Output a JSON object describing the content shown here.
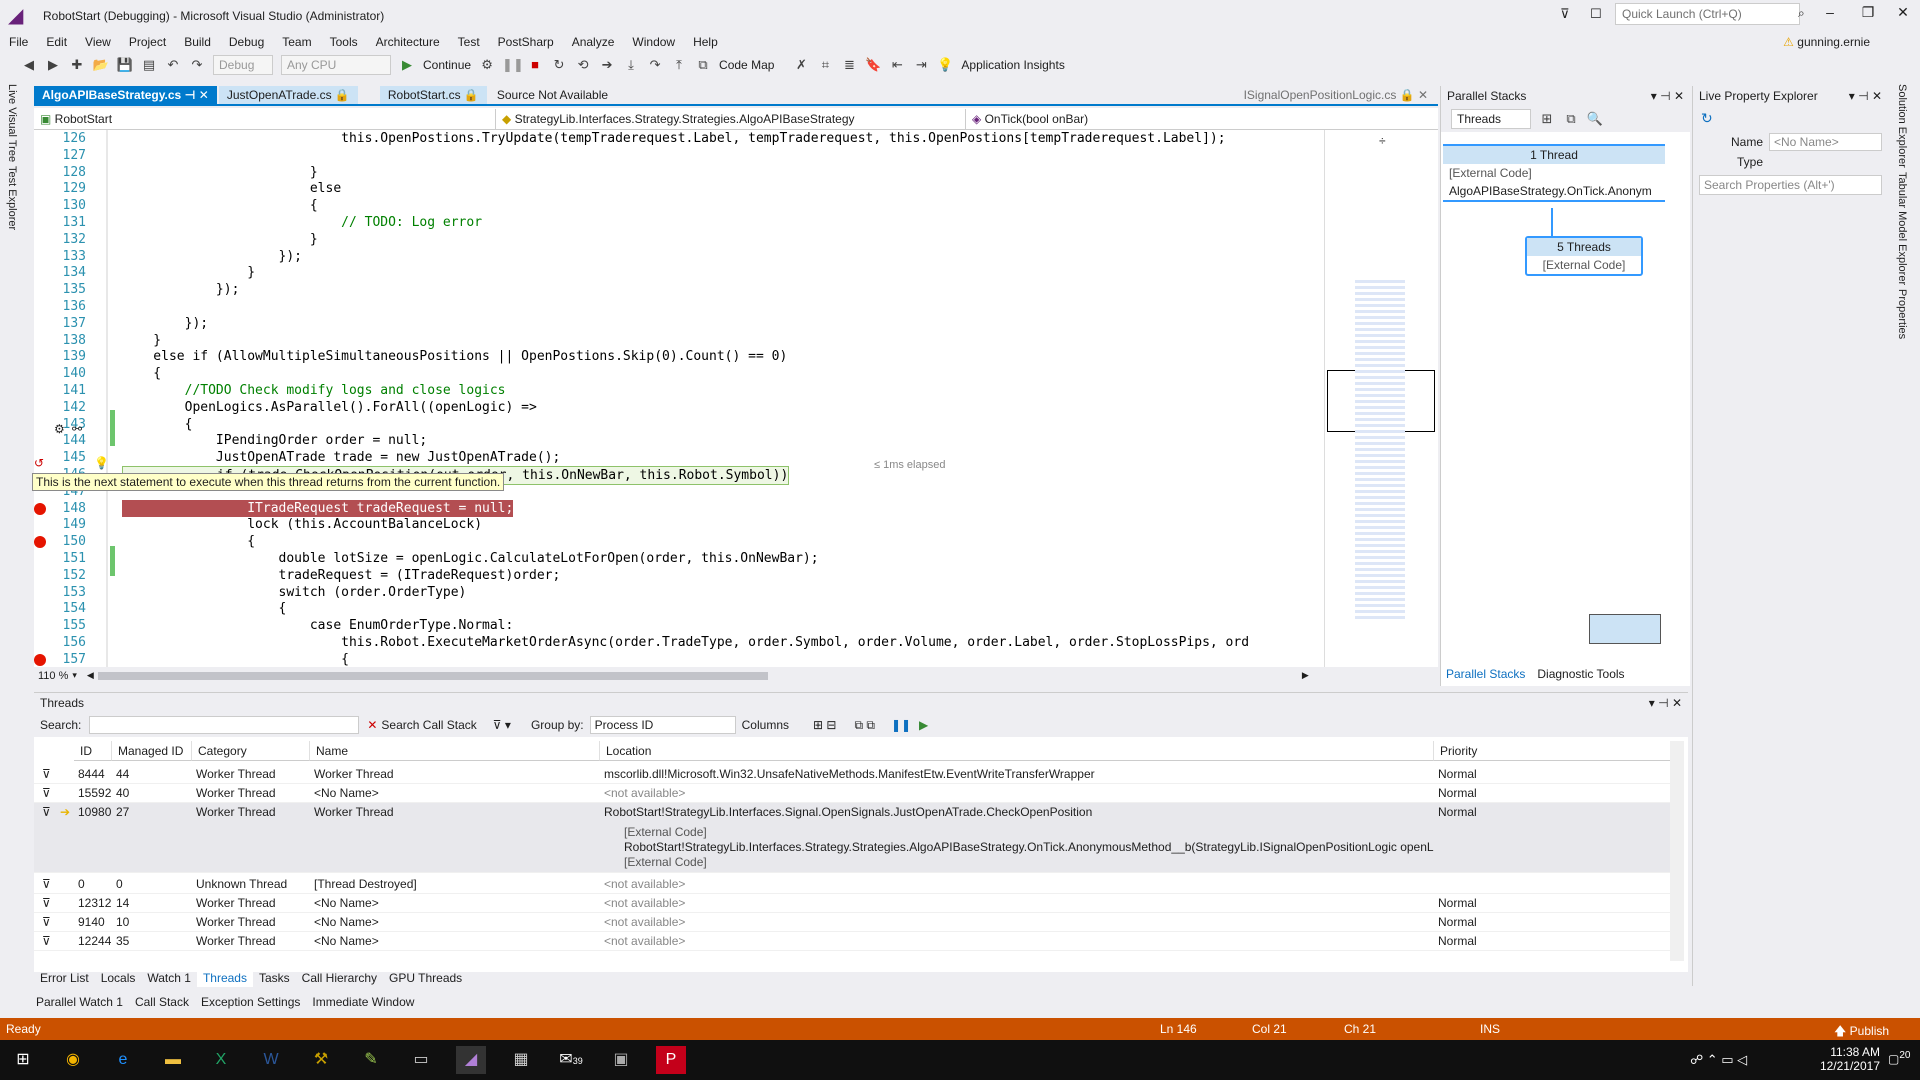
{
  "window": {
    "title": "RobotStart (Debugging) - Microsoft Visual Studio (Administrator)",
    "quick_launch_placeholder": "Quick Launch (Ctrl+Q)",
    "user": "gunning.ernie"
  },
  "menu": [
    "File",
    "Edit",
    "View",
    "Project",
    "Build",
    "Debug",
    "Team",
    "Tools",
    "Architecture",
    "Test",
    "PostSharp",
    "Analyze",
    "Window",
    "Help"
  ],
  "toolbar": {
    "config": "Debug",
    "platform": "Any CPU",
    "continue_label": "Continue",
    "code_map_label": "Code Map",
    "app_insights_label": "Application Insights"
  },
  "left_strip": [
    "Live Visual Tree",
    "Test Explorer"
  ],
  "right_strip": [
    "Solution Explorer",
    "Tabular Model Explorer",
    "Properties"
  ],
  "doc_tabs": [
    {
      "label": "AlgoAPIBaseStrategy.cs",
      "active": true
    },
    {
      "label": "JustOpenATrade.cs",
      "active": false
    },
    {
      "label": "RobotStart.cs",
      "active": false
    },
    {
      "label": "Source Not Available",
      "active": false
    },
    {
      "label": "ISignalOpenPositionLogic.cs",
      "active": false
    }
  ],
  "nav_bar": {
    "project": "RobotStart",
    "class": "StrategyLib.Interfaces.Strategy.Strategies.AlgoAPIBaseStrategy",
    "method": "OnTick(bool onBar)"
  },
  "code_lines": [
    {
      "n": "126",
      "t": "                            this.OpenPostions.TryUpdate(tempTraderequest.Label, tempTraderequest, this.OpenPostions[tempTraderequest.Label]);"
    },
    {
      "n": "127",
      "t": ""
    },
    {
      "n": "128",
      "t": "                        }"
    },
    {
      "n": "129",
      "t": "                        else"
    },
    {
      "n": "130",
      "t": "                        {"
    },
    {
      "n": "131",
      "t": "                            // TODO: Log error"
    },
    {
      "n": "132",
      "t": "                        }"
    },
    {
      "n": "133",
      "t": "                    });"
    },
    {
      "n": "134",
      "t": "                }"
    },
    {
      "n": "135",
      "t": "            });"
    },
    {
      "n": "136",
      "t": ""
    },
    {
      "n": "137",
      "t": "        });"
    },
    {
      "n": "138",
      "t": "    }"
    },
    {
      "n": "139",
      "t": "    else if (AllowMultipleSimultaneousPositions || OpenPostions.Skip(0).Count() == 0)"
    },
    {
      "n": "140",
      "t": "    {"
    },
    {
      "n": "141",
      "t": "        //TODO Check modify logs and close logics"
    },
    {
      "n": "142",
      "t": "        OpenLogics.AsParallel().ForAll((openLogic) =>"
    },
    {
      "n": "143",
      "t": "        {"
    },
    {
      "n": "144",
      "t": "            IPendingOrder order = null;"
    },
    {
      "n": "145",
      "t": "            JustOpenATrade trade = new JustOpenATrade();"
    },
    {
      "n": "146",
      "t": "            if (trade.CheckOpenPosition(out order, this.OnNewBar, this.Robot.Symbol))"
    },
    {
      "n": "147",
      "t": ""
    },
    {
      "n": "148",
      "t": "                ITradeRequest tradeRequest = null;"
    },
    {
      "n": "149",
      "t": "                lock (this.AccountBalanceLock)"
    },
    {
      "n": "150",
      "t": "                {"
    },
    {
      "n": "151",
      "t": "                    double lotSize = openLogic.CalculateLotForOpen(order, this.OnNewBar);"
    },
    {
      "n": "152",
      "t": "                    tradeRequest = (ITradeRequest)order;"
    },
    {
      "n": "153",
      "t": "                    switch (order.OrderType)"
    },
    {
      "n": "154",
      "t": "                    {"
    },
    {
      "n": "155",
      "t": "                        case EnumOrderType.Normal:"
    },
    {
      "n": "156",
      "t": "                            this.Robot.ExecuteMarketOrderAsync(order.TradeType, order.Symbol, order.Volume, order.Label, order.StopLossPips, ord"
    },
    {
      "n": "157",
      "t": "                            {"
    }
  ],
  "elapsed_hint": "≤ 1ms elapsed",
  "tooltip": "This is the next statement to execute when this thread returns from the current function.",
  "zoom": "110 %",
  "parallel_stacks": {
    "title": "Parallel Stacks",
    "view_combo": "Threads",
    "node1_header": "1 Thread",
    "node1_rows": [
      "[External Code]",
      "AlgoAPIBaseStrategy.OnTick.Anonym"
    ],
    "node2_header": "5 Threads",
    "node2_rows": [
      "[External Code]"
    ],
    "tabs": [
      "Parallel Stacks",
      "Diagnostic Tools"
    ]
  },
  "live_property_explorer": {
    "title": "Live Property Explorer",
    "name_label": "Name",
    "name_value": "<No Name>",
    "type_label": "Type",
    "search_placeholder": "Search Properties (Alt+')"
  },
  "threads": {
    "title": "Threads",
    "search_label": "Search:",
    "search_call_stack": "Search Call Stack",
    "group_by_label": "Group by:",
    "group_by_value": "Process ID",
    "columns_label": "Columns",
    "headers": [
      "ID",
      "Managed ID",
      "Category",
      "Name",
      "Location",
      "Priority"
    ],
    "rows": [
      {
        "id": "8444",
        "mid": "44",
        "cat": "Worker Thread",
        "name": "Worker Thread",
        "loc": "mscorlib.dll!Microsoft.Win32.UnsafeNativeMethods.ManifestEtw.EventWriteTransferWrapper",
        "pri": "Normal"
      },
      {
        "id": "15592",
        "mid": "40",
        "cat": "Worker Thread",
        "name": "<No Name>",
        "loc": "<not available>",
        "pri": "Normal"
      },
      {
        "id": "10980",
        "mid": "27",
        "cat": "Worker Thread",
        "name": "Worker Thread",
        "loc": "RobotStart!StrategyLib.Interfaces.Signal.OpenSignals.JustOpenATrade.CheckOpenPosition",
        "pri": "Normal"
      },
      {
        "id": "0",
        "mid": "0",
        "cat": "Unknown Thread",
        "name": "[Thread Destroyed]",
        "loc": "<not available>",
        "pri": ""
      },
      {
        "id": "12312",
        "mid": "14",
        "cat": "Worker Thread",
        "name": "<No Name>",
        "loc": "<not available>",
        "pri": "Normal"
      },
      {
        "id": "9140",
        "mid": "10",
        "cat": "Worker Thread",
        "name": "<No Name>",
        "loc": "<not available>",
        "pri": "Normal"
      },
      {
        "id": "12244",
        "mid": "35",
        "cat": "Worker Thread",
        "name": "<No Name>",
        "loc": "<not available>",
        "pri": "Normal"
      }
    ],
    "expanded_stack": [
      "[External Code]",
      "RobotStart!StrategyLib.Interfaces.Strategy.Strategies.AlgoAPIBaseStrategy.OnTick.AnonymousMethod__b(StrategyLib.ISignalOpenPositionLogic openLo",
      "[External Code]"
    ]
  },
  "bottom_tabs1": [
    "Error List",
    "Locals",
    "Watch 1",
    "Threads",
    "Tasks",
    "Call Hierarchy",
    "GPU Threads"
  ],
  "bottom_tabs2": [
    "Parallel Watch 1",
    "Call Stack",
    "Exception Settings",
    "Immediate Window"
  ],
  "status": {
    "ready": "Ready",
    "ln": "Ln 146",
    "col": "Col 21",
    "ch": "Ch 21",
    "ins": "INS",
    "publish": "Publish"
  },
  "taskbar": {
    "time": "11:38 AM",
    "date": "12/21/2017",
    "notif_count": "20",
    "mail_badge": "39"
  },
  "colors": {
    "accent": "#007acc",
    "status_debug": "#ca5100",
    "breakpoint": "#e51400"
  }
}
